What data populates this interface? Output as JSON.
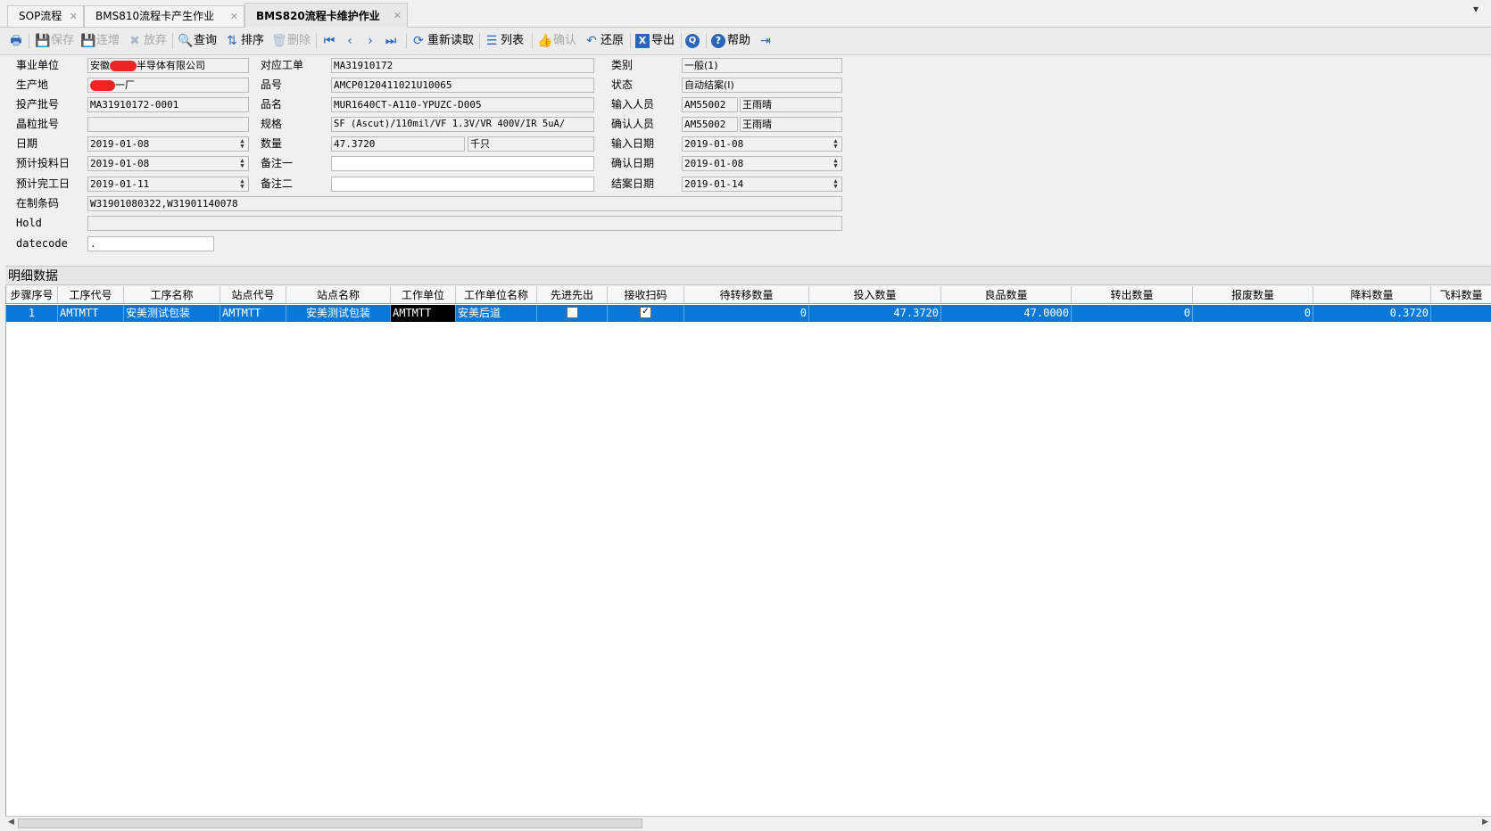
{
  "tabs": [
    {
      "label": "SOP流程"
    },
    {
      "label": "BMS810流程卡产生作业"
    },
    {
      "label": "BMS820流程卡维护作业"
    }
  ],
  "toolbar": {
    "save": "保存",
    "continue_add": "连增",
    "discard": "放弃",
    "query": "查询",
    "sort": "排序",
    "delete": "删除",
    "reload": "重新读取",
    "list": "列表",
    "confirm": "确认",
    "restore": "还原",
    "export": "导出",
    "help": "帮助"
  },
  "form": {
    "business_unit": {
      "label": "事业单位",
      "value": "安徽",
      "value_suffix": "半导体有限公司"
    },
    "production_site": {
      "label": "生产地",
      "value": "一厂"
    },
    "lot_no": {
      "label": "投产批号",
      "value": "MA31910172-0001"
    },
    "wafer_lot": {
      "label": "晶粒批号",
      "value": ""
    },
    "date": {
      "label": "日期",
      "value": "2019-01-08"
    },
    "plan_feed_date": {
      "label": "预计投料日",
      "value": "2019-01-08"
    },
    "plan_done_date": {
      "label": "预计完工日",
      "value": "2019-01-11"
    },
    "wip_barcode": {
      "label": "在制条码",
      "value": "W31901080322,W31901140078"
    },
    "hold": {
      "label": "Hold",
      "value": ""
    },
    "datecode": {
      "label": "datecode",
      "value": "."
    },
    "work_order": {
      "label": "对应工单",
      "value": "MA31910172"
    },
    "part_no": {
      "label": "品号",
      "value": "AMCP0120411021U10065"
    },
    "part_name": {
      "label": "品名",
      "value": "MUR1640CT-A110-YPUZC-D005"
    },
    "spec": {
      "label": "规格",
      "value": "SF (Ascut)/110mil/VF 1.3V/VR 400V/IR 5uA/"
    },
    "quantity": {
      "label": "数量",
      "value": "47.3720",
      "unit": "千只"
    },
    "remark1": {
      "label": "备注一",
      "value": ""
    },
    "remark2": {
      "label": "备注二",
      "value": ""
    },
    "category": {
      "label": "类别",
      "value": "一般(1)"
    },
    "status": {
      "label": "状态",
      "value": "自动结案(I)"
    },
    "input_user": {
      "label": "输入人员",
      "id": "AM55002",
      "name": "王雨晴"
    },
    "confirm_user": {
      "label": "确认人员",
      "id": "AM55002",
      "name": "王雨晴"
    },
    "input_date": {
      "label": "输入日期",
      "value": "2019-01-08"
    },
    "confirm_date": {
      "label": "确认日期",
      "value": "2019-01-08"
    },
    "close_date": {
      "label": "结案日期",
      "value": "2019-01-14"
    }
  },
  "detail": {
    "title": "明细数据",
    "columns": [
      "步骤序号",
      "工序代号",
      "工序名称",
      "站点代号",
      "站点名称",
      "工作单位",
      "工作单位名称",
      "先进先出",
      "接收扫码",
      "待转移数量",
      "投入数量",
      "良品数量",
      "转出数量",
      "报废数量",
      "降料数量",
      "飞料数量"
    ],
    "rows": [
      {
        "step": "1",
        "op_code": "AMTMTT",
        "op_name": "安美测试包装",
        "station_code": "AMTMTT",
        "station_name": "安美测试包装",
        "work_unit": "AMTMTT",
        "work_unit_name": "安美后道",
        "fifo": false,
        "scan": true,
        "pending": "0",
        "input": "47.3720",
        "good": "47.0000",
        "out": "0",
        "scrap": "0",
        "downgrade": "0.3720",
        "fly": ""
      }
    ]
  }
}
